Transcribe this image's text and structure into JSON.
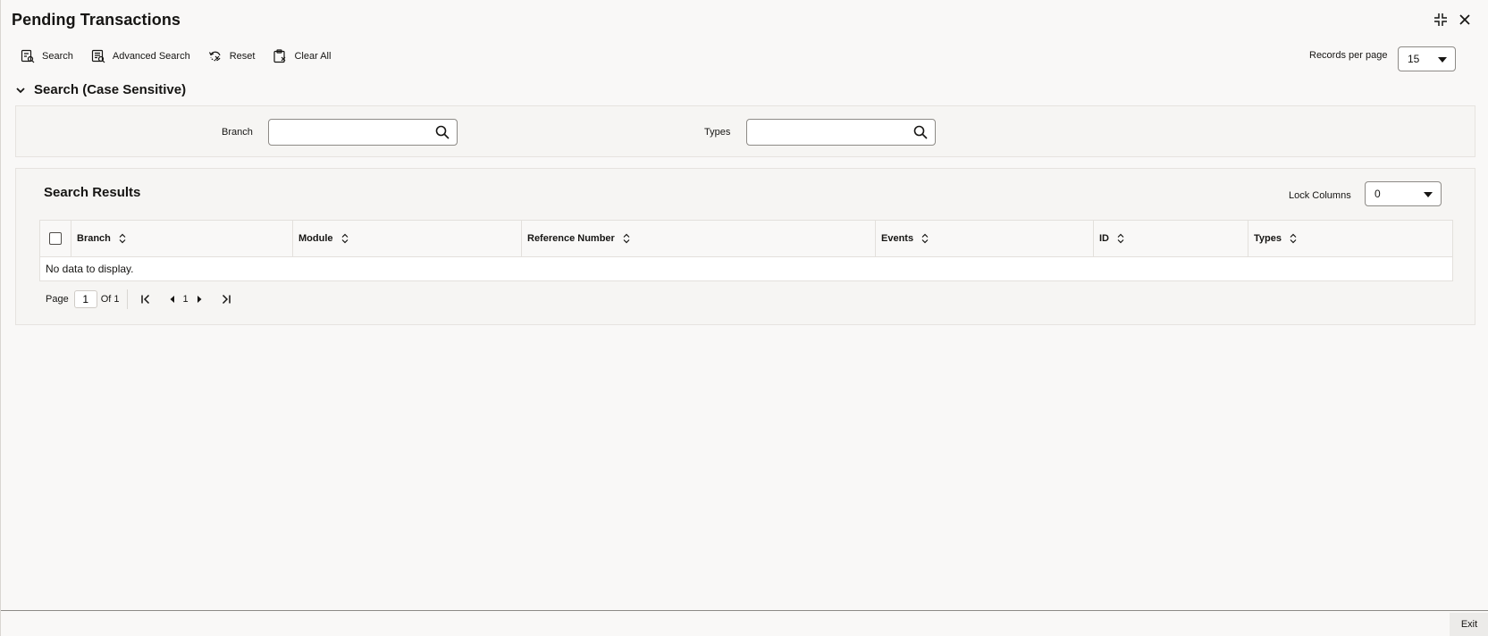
{
  "window": {
    "title": "Pending Transactions"
  },
  "toolbar": {
    "search": "Search",
    "advanced_search": "Advanced Search",
    "reset": "Reset",
    "clear_all": "Clear All"
  },
  "records_per_page": {
    "label": "Records per page",
    "value": "15"
  },
  "search_section": {
    "title": "Search (Case Sensitive)",
    "branch_label": "Branch",
    "branch_value": "",
    "types_label": "Types",
    "types_value": ""
  },
  "results": {
    "title": "Search Results",
    "lock_columns_label": "Lock Columns",
    "lock_columns_value": "0",
    "columns": [
      "Branch",
      "Module",
      "Reference Number",
      "Events",
      "ID",
      "Types"
    ],
    "empty_message": "No data to display."
  },
  "pagination": {
    "page_label": "Page",
    "current_page": "1",
    "of_label": "Of 1",
    "page_number": "1"
  },
  "footer": {
    "exit": "Exit"
  }
}
